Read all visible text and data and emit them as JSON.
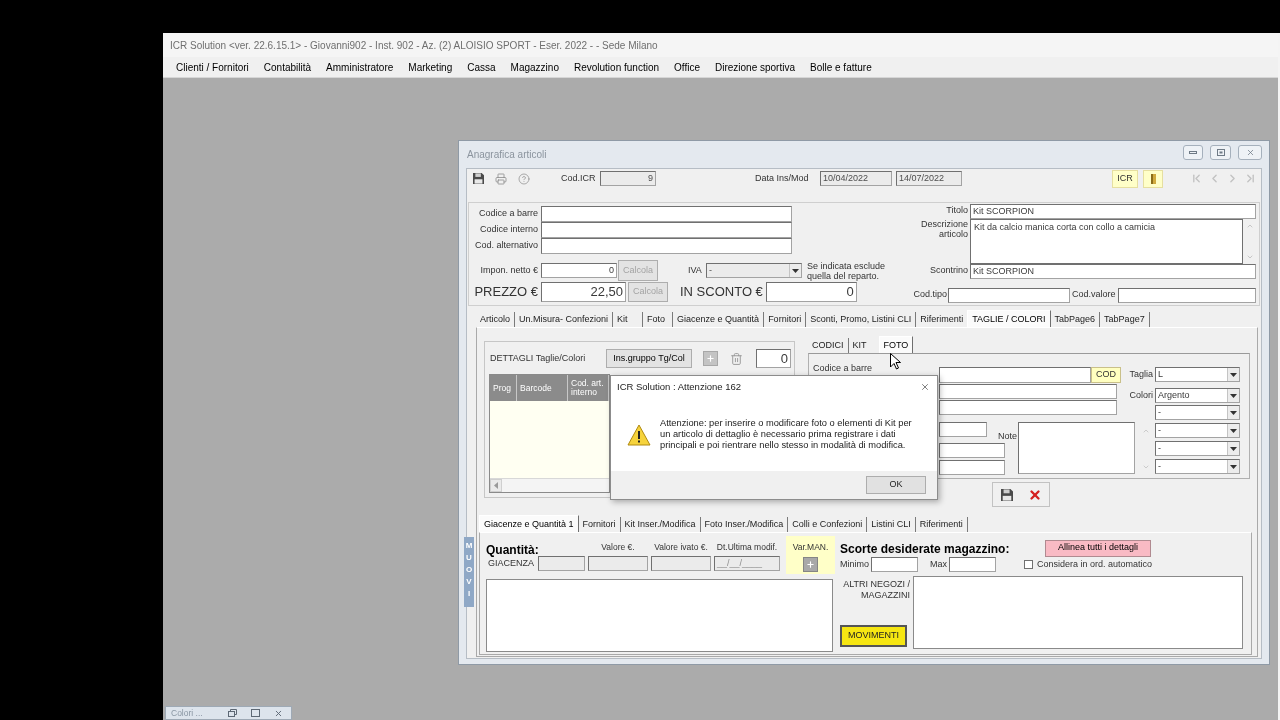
{
  "app": {
    "title": "ICR Solution <ver. 22.6.15.1> - Giovanni902 - Inst. 902 - Az. (2) ALOISIO SPORT - Eser. 2022 - - Sede Milano"
  },
  "menu": [
    "Clienti / Fornitori",
    "Contabilità",
    "Amministratore",
    "Marketing",
    "Cassa",
    "Magazzino",
    "Revolution function",
    "Office",
    "Direzione sportiva",
    "Bolle e fatture"
  ],
  "window": {
    "title": "Anagrafica articoli"
  },
  "toolbar": {
    "cod_icr": {
      "label": "Cod.ICR",
      "value": "9",
      "disabled": true
    },
    "dates_label": "Data Ins/Mod",
    "dates": [
      {
        "value": "10/04/2022",
        "disabled": true
      },
      {
        "value": "14/07/2022",
        "disabled": true
      }
    ],
    "icr_button": "ICR"
  },
  "article": {
    "codes": [
      {
        "label": "Codice a barre"
      },
      {
        "label": "Codice interno"
      },
      {
        "label": "Cod. alternativo"
      }
    ],
    "net_price": {
      "label": "Impon. netto €",
      "value": "0",
      "button": {
        "label": "Calcola",
        "disabled": true
      }
    },
    "vat": {
      "label": "IVA",
      "value": "-",
      "disabled": true,
      "note": "Se indicata esclude quella del reparto."
    },
    "price": {
      "label": "PREZZO €",
      "value": "22,50",
      "button": {
        "label": "Calcola",
        "disabled": true
      }
    },
    "discount": {
      "label": "IN SCONTO €",
      "value": "0"
    },
    "title": {
      "label": "Titolo",
      "value": "Kit SCORPION"
    },
    "description": {
      "label": "Descrizione articolo",
      "value": "Kit da calcio manica corta con collo a camicia"
    },
    "receipt": {
      "label": "Scontrino",
      "value": "Kit SCORPION"
    },
    "type_code": {
      "label": "Cod.tipo"
    },
    "type_value": {
      "label": "Cod.valore"
    }
  },
  "tabs": [
    {
      "label": "Articolo",
      "selected": false
    },
    {
      "label": "Un.Misura- Confezioni",
      "selected": false
    },
    {
      "label": "Kit",
      "selected": false
    },
    {
      "label": "Foto",
      "selected": false
    },
    {
      "label": "Giacenze e Quantità",
      "selected": false
    },
    {
      "label": "Fornitori",
      "selected": false
    },
    {
      "label": "Sconti, Promo, Listini CLI",
      "selected": false
    },
    {
      "label": "Riferimenti",
      "selected": false
    },
    {
      "label": "TAGLIE / COLORI",
      "selected": true
    },
    {
      "label": "TabPage6",
      "selected": false
    },
    {
      "label": "TabPage7",
      "selected": false
    }
  ],
  "sizes_colors": {
    "title": "DETTAGLI Taglie/Colori",
    "group_button": "Ins.gruppo Tg/Col",
    "count": "0",
    "columns": [
      "Prog",
      "Barcode",
      "Cod. art. interno"
    ],
    "subtabs": [
      {
        "label": "CODICI",
        "selected": false
      },
      {
        "label": "KIT",
        "selected": false
      },
      {
        "label": "FOTO",
        "selected": true
      }
    ],
    "barcode_label": "Codice a barre",
    "cod_button": "COD",
    "size": {
      "label": "Taglia",
      "value": "L"
    },
    "colors": {
      "label": "Colori",
      "values": [
        "Argento",
        "-",
        "-",
        "-",
        "-"
      ]
    },
    "note_label": "Note"
  },
  "stock_tabs": [
    {
      "label": "Giacenze e Quantità 1",
      "selected": true
    },
    {
      "label": "Fornitori",
      "selected": false
    },
    {
      "label": "Kit Inser./Modifica",
      "selected": false
    },
    {
      "label": "Foto Inser./Modifica",
      "selected": false
    },
    {
      "label": "Colli e Confezioni",
      "selected": false
    },
    {
      "label": "Listini CLI",
      "selected": false
    },
    {
      "label": "Riferimenti",
      "selected": false
    }
  ],
  "side_tab": "MUOVI",
  "stock": {
    "title": "Quantità:",
    "columns": [
      "Valore €.",
      "Valore ivato €.",
      "Dt.Ultima modif."
    ],
    "row_label": "GIACENZA",
    "date_placeholder": "__/__/____",
    "manual_label": "Var.MAN."
  },
  "reorder": {
    "title": "Scorte desiderate magazzino:",
    "align_button": "Allinea tutti i dettagli",
    "min_label": "Minimo",
    "max_label": "Max",
    "auto_order": {
      "label": "Considera in ord. automatico",
      "checked": false
    },
    "stores_label": "ALTRI NEGOZI / MAGAZZINI",
    "movements_button": "MOVIMENTI"
  },
  "dialog": {
    "title": "ICR Solution : Attenzione 162",
    "message": "Attenzione: per inserire o modificare foto o elementi di Kit per un articolo di dettaglio è necessario prima registrare i dati principali e poi rientrare nello stesso in modalità di modifica.",
    "button": "OK"
  },
  "minimized_window": {
    "title": "Colori ..."
  }
}
